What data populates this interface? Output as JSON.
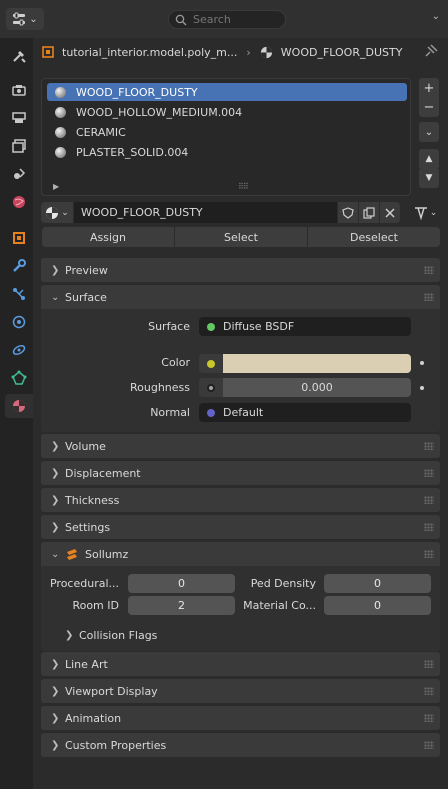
{
  "header": {
    "search_placeholder": "Search"
  },
  "breadcrumb": {
    "object": "tutorial_interior.model.poly_m...",
    "material": "WOOD_FLOOR_DUSTY"
  },
  "slots": [
    {
      "name": "WOOD_FLOOR_DUSTY"
    },
    {
      "name": "WOOD_HOLLOW_MEDIUM.004"
    },
    {
      "name": "CERAMIC"
    },
    {
      "name": "PLASTER_SOLID.004"
    }
  ],
  "material": {
    "name": "WOOD_FLOOR_DUSTY"
  },
  "actions": {
    "assign": "Assign",
    "select": "Select",
    "deselect": "Deselect"
  },
  "panels": {
    "preview": "Preview",
    "surface": "Surface",
    "volume": "Volume",
    "displacement": "Displacement",
    "thickness": "Thickness",
    "settings": "Settings",
    "sollumz": "Sollumz",
    "line_art": "Line Art",
    "viewport_display": "Viewport Display",
    "animation": "Animation",
    "custom_properties": "Custom Properties"
  },
  "surface": {
    "surface_label": "Surface",
    "shader": "Diffuse BSDF",
    "color_label": "Color",
    "color_value": "#dbcfb3",
    "roughness_label": "Roughness",
    "roughness_value": "0.000",
    "normal_label": "Normal",
    "normal_value": "Default"
  },
  "sollumz": {
    "procedural_label": "Procedural...",
    "procedural_value": "0",
    "ped_density_label": "Ped Density",
    "ped_density_value": "0",
    "room_id_label": "Room ID",
    "room_id_value": "2",
    "material_co_label": "Material Co...",
    "material_co_value": "0",
    "collision_flags": "Collision Flags"
  },
  "colors": {
    "accent": "#4772b3",
    "socket_shader": "#63c763",
    "socket_float": "#a1a1a1",
    "socket_color": "#c7c729",
    "socket_vector": "#6363c7"
  }
}
